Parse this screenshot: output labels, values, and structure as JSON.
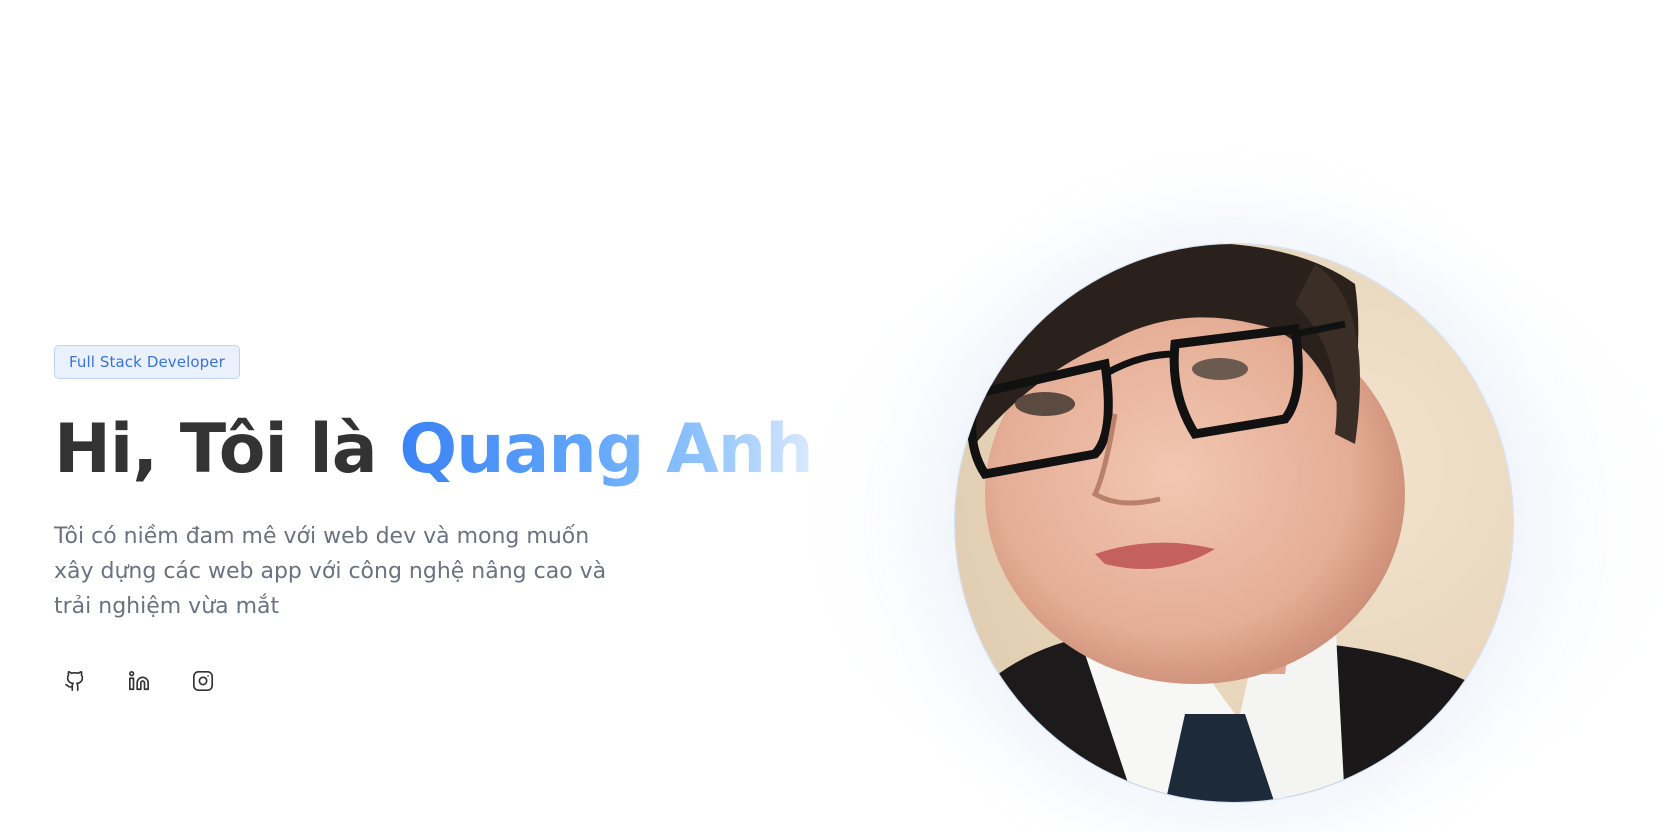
{
  "hero": {
    "badge": "Full Stack Developer",
    "greeting": "Hi, Tôi là ",
    "name": "Quang Anh",
    "description": "Tôi có niềm đam mê với web dev và mong muốn xây dựng các web app với công nghệ nâng cao và trải nghiệm vừa mắt",
    "avatar_alt": "Quang Anh"
  },
  "socials": [
    {
      "icon": "github-icon"
    },
    {
      "icon": "linkedin-icon"
    },
    {
      "icon": "instagram-icon"
    }
  ],
  "colors": {
    "accent": "#3b82f6",
    "badge_bg": "#eaf1fd",
    "badge_text": "#3b73d9",
    "heading": "#333333",
    "body_text": "#6b7280"
  }
}
